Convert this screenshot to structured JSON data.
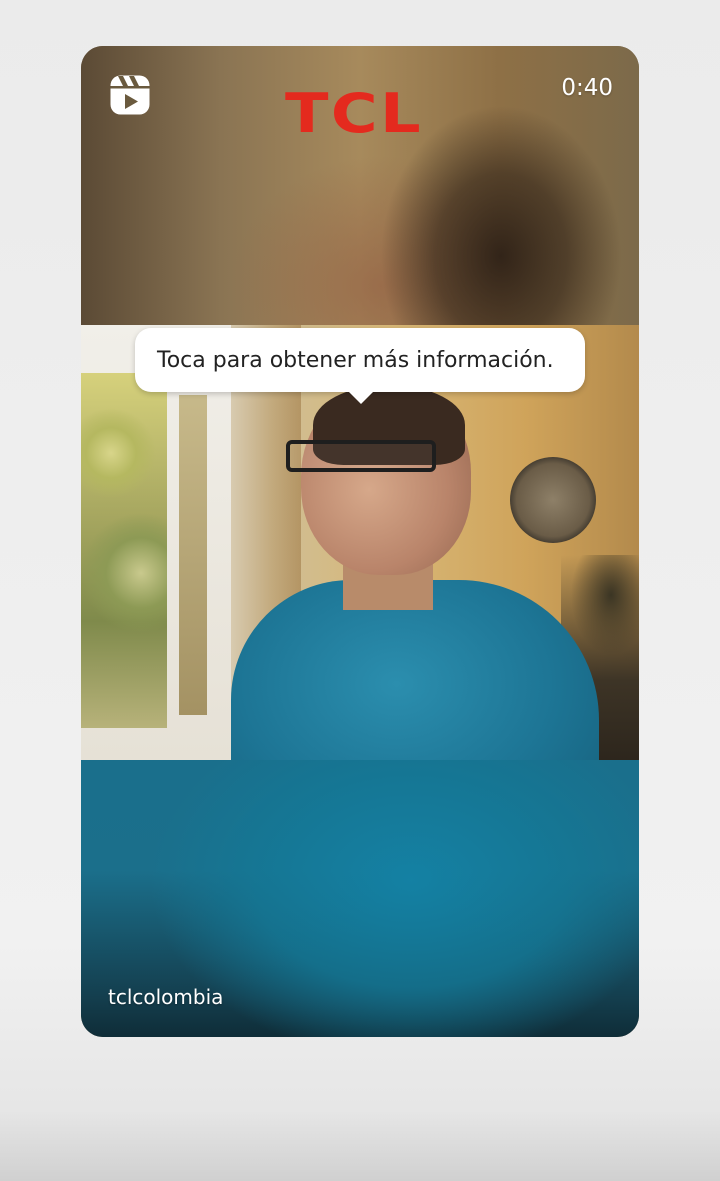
{
  "reel": {
    "reels_icon": "reels-icon",
    "brand_logo_text": "TCL",
    "duration": "0:40",
    "tooltip_text": "Toca para obtener más información.",
    "username": "tclcolombia"
  },
  "colors": {
    "brand_red": "#e42a1e",
    "tooltip_bg": "#ffffff",
    "text_light": "#ffffff",
    "shirt_teal": "#1d7595"
  }
}
